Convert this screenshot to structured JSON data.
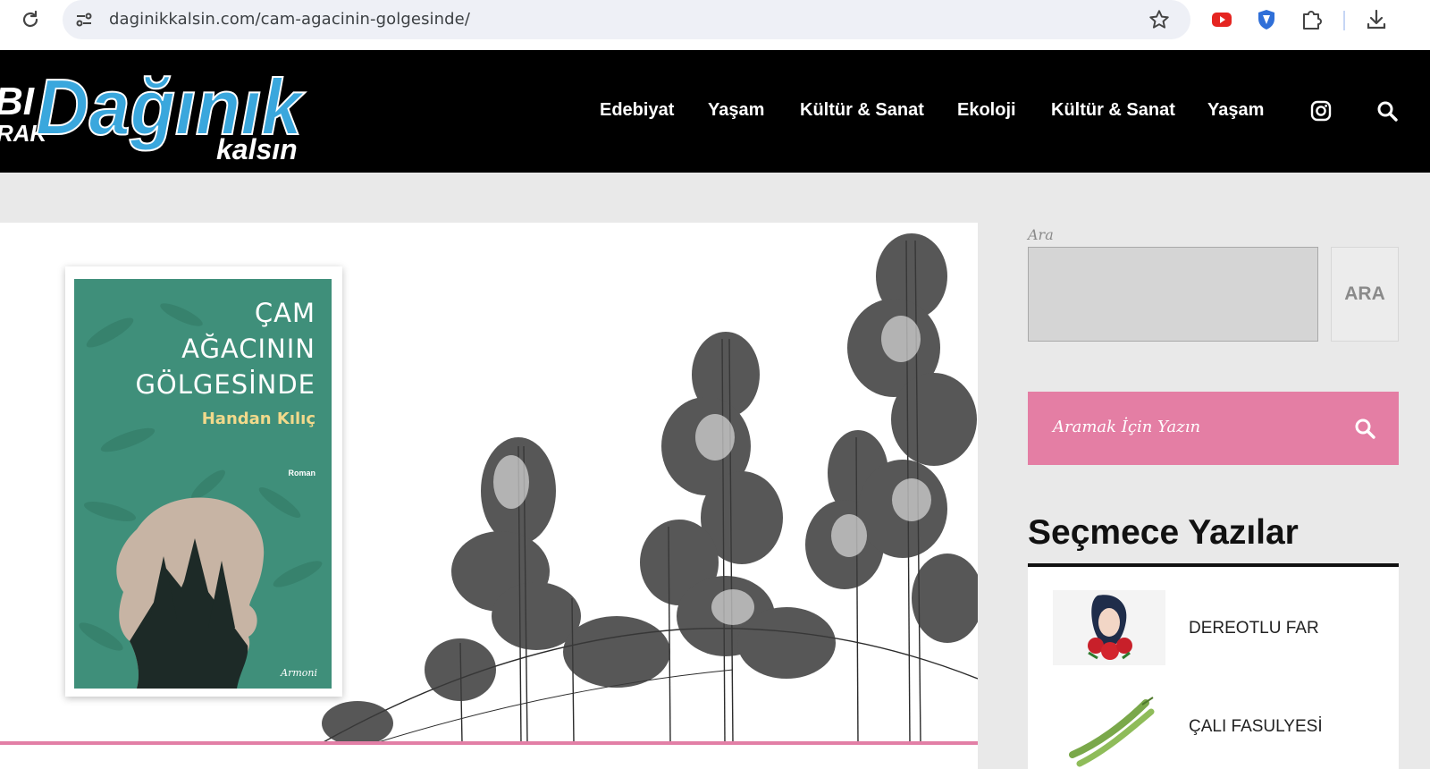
{
  "browser": {
    "url": "daginikkalsin.com/cam-agacinin-golgesinde/",
    "toolbar_icons": [
      "reload-icon",
      "site-info-icon",
      "bookmark-star-icon",
      "youtube-extension-icon",
      "shield-extension-icon",
      "extensions-puzzle-icon",
      "download-icon"
    ]
  },
  "header": {
    "logo": {
      "text_left_top": "BI",
      "text_left_bottom": "RAK",
      "text_main": "Dağınık",
      "text_sub": "kalsın"
    },
    "nav": [
      {
        "label": "Edebiyat"
      },
      {
        "label": "Yaşam"
      },
      {
        "label": "Kültür & Sanat"
      },
      {
        "label": "Ekoloji"
      },
      {
        "label": "Kültür & Sanat"
      },
      {
        "label": "Yaşam"
      }
    ],
    "icons": [
      "instagram-icon",
      "search-icon"
    ]
  },
  "hero": {
    "book": {
      "title_lines": [
        "ÇAM",
        "AĞACININ",
        "GÖLGESİNDE"
      ],
      "author": "Handan Kılıç",
      "genre": "Roman",
      "publisher": "Armoni"
    }
  },
  "sidebar": {
    "search": {
      "label": "Ara",
      "button": "ARA"
    },
    "pink_search": {
      "placeholder": "Aramak İçin Yazın"
    },
    "featured": {
      "title": "Seçmece Yazılar",
      "posts": [
        {
          "title": "DEREOTLU FAR"
        },
        {
          "title": "ÇALI FASULYESİ"
        }
      ]
    }
  },
  "colors": {
    "header_bg": "#000000",
    "logo_blue": "#3aa7dd",
    "accent_pink": "#e47ea4",
    "book_green": "#3f8f7a"
  }
}
